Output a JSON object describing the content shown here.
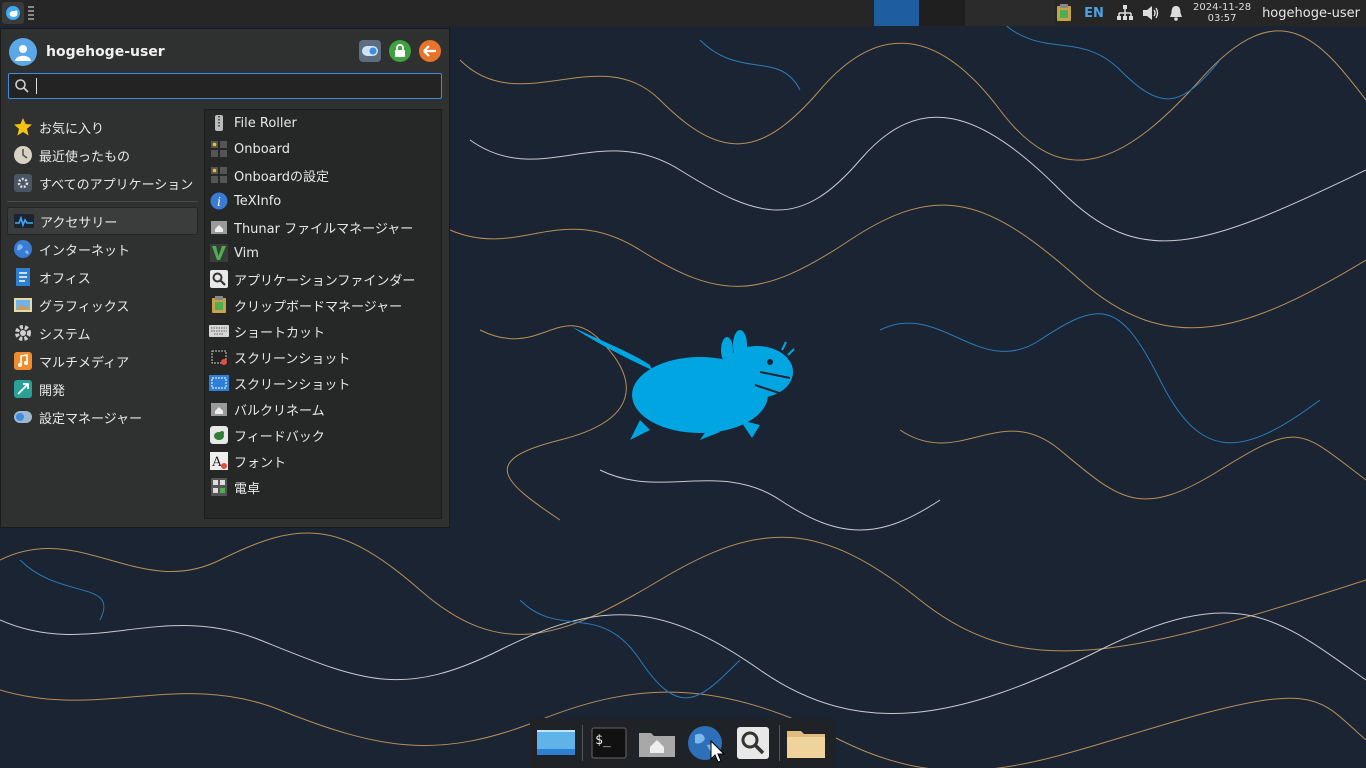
{
  "top_panel": {
    "language": "EN",
    "date": "2024-11-28",
    "time": "03:57",
    "user": "hogehoge-user"
  },
  "menu": {
    "username": "hogehoge-user",
    "search_value": "",
    "categories": [
      {
        "label": "お気に入り",
        "icon": "star-icon"
      },
      {
        "label": "最近使ったもの",
        "icon": "clock-icon"
      },
      {
        "label": "すべてのアプリケーション",
        "icon": "applications-icon"
      },
      {
        "label": "アクセサリー",
        "icon": "accessories-icon",
        "active": true
      },
      {
        "label": "インターネット",
        "icon": "globe-icon"
      },
      {
        "label": "オフィス",
        "icon": "office-icon"
      },
      {
        "label": "グラフィックス",
        "icon": "graphics-icon"
      },
      {
        "label": "システム",
        "icon": "gear-icon"
      },
      {
        "label": "マルチメディア",
        "icon": "music-icon"
      },
      {
        "label": "開発",
        "icon": "development-icon"
      },
      {
        "label": "設定マネージャー",
        "icon": "settings-manager-icon"
      }
    ],
    "apps": [
      {
        "label": "File Roller",
        "icon": "archive-icon"
      },
      {
        "label": "Onboard",
        "icon": "keyboard-icon"
      },
      {
        "label": "Onboardの設定",
        "icon": "keyboard-settings-icon"
      },
      {
        "label": "TeXInfo",
        "icon": "info-icon"
      },
      {
        "label": "Thunar ファイルマネージャー",
        "icon": "file-manager-icon"
      },
      {
        "label": "Vim",
        "icon": "vim-icon"
      },
      {
        "label": "アプリケーションファインダー",
        "icon": "app-finder-icon"
      },
      {
        "label": "クリップボードマネージャー",
        "icon": "clipboard-icon"
      },
      {
        "label": "ショートカット",
        "icon": "shortcut-keyboard-icon"
      },
      {
        "label": "スクリーンショット",
        "icon": "screenshot-icon"
      },
      {
        "label": "スクリーンショット",
        "icon": "screenshot-blue-icon"
      },
      {
        "label": "バルクリネーム",
        "icon": "bulk-rename-icon"
      },
      {
        "label": "フィードバック",
        "icon": "feedback-icon"
      },
      {
        "label": "フォント",
        "icon": "font-icon"
      },
      {
        "label": "電卓",
        "icon": "calculator-icon"
      }
    ]
  },
  "dock": {
    "terminal_label": "$_"
  },
  "colors": {
    "accent": "#3d8ee0",
    "mouse_logo": "#00a5e2",
    "wallpaper": "#1b2433"
  }
}
